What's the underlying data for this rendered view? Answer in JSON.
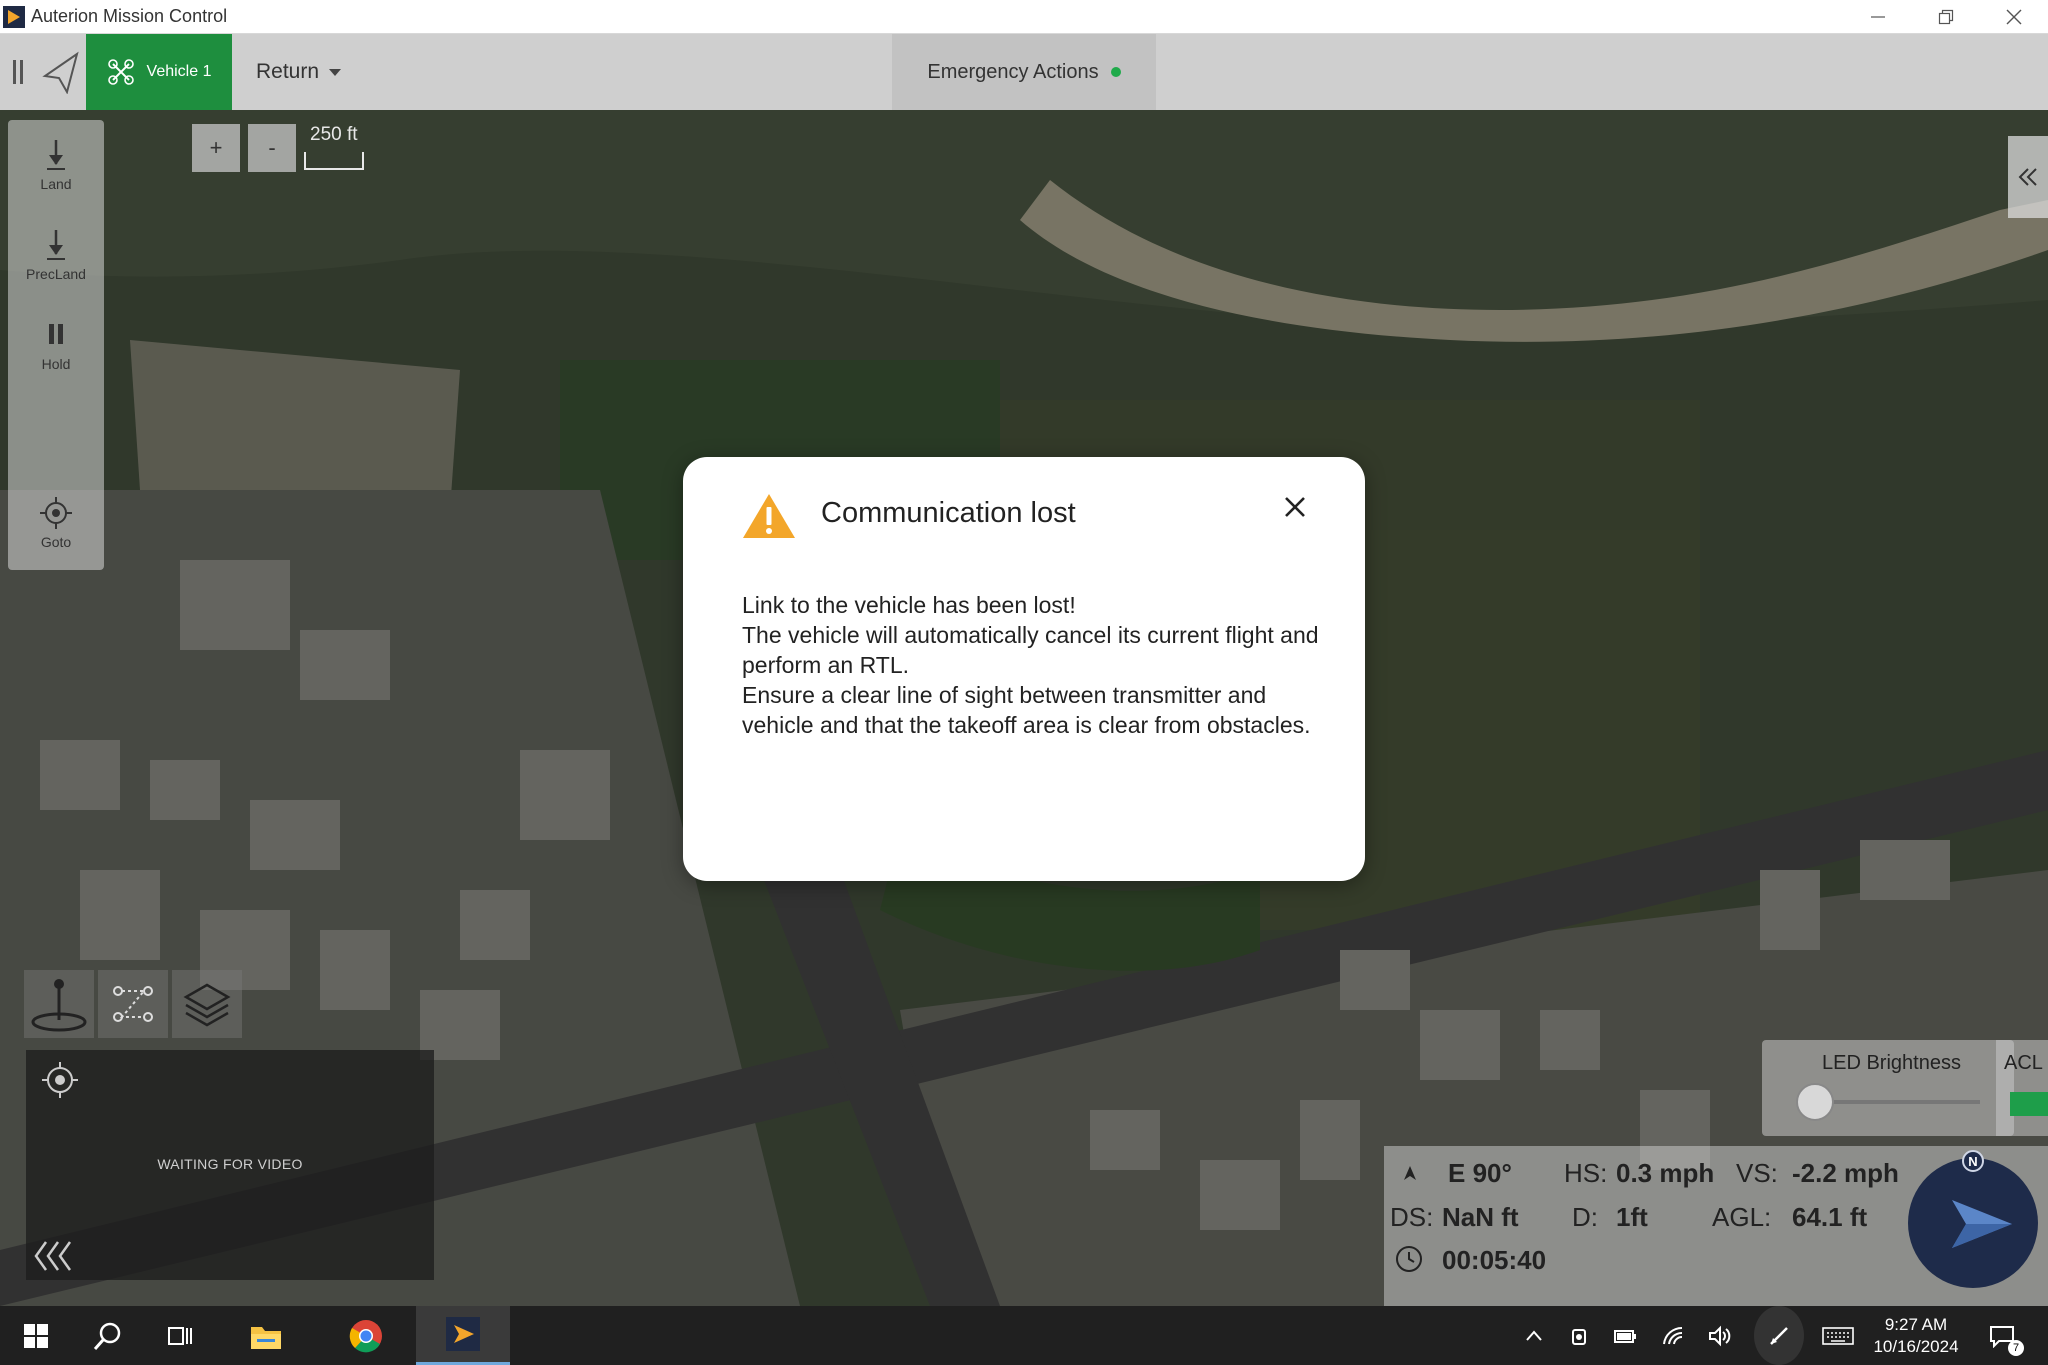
{
  "window": {
    "title": "Auterion Mission Control"
  },
  "toolbar": {
    "vehicle_label": "Vehicle 1",
    "mode_label": "Return",
    "emergency_label": "Emergency Actions",
    "status_color": "#1faa4a"
  },
  "map": {
    "zoom_in": "+",
    "zoom_out": "-",
    "scale": "250 ft"
  },
  "actions": [
    {
      "label": "Land",
      "icon": "land-icon"
    },
    {
      "label": "PrecLand",
      "icon": "precland-icon"
    },
    {
      "label": "Hold",
      "icon": "pause-icon"
    },
    {
      "label": "Goto",
      "icon": "target-icon"
    }
  ],
  "dialog": {
    "title": "Communication lost",
    "lines": [
      "Link to the vehicle has been lost!",
      "The vehicle will automatically cancel its current flight and perform an RTL.",
      "Ensure a clear line of sight between transmitter and vehicle and that the takeoff area is clear from obstacles."
    ]
  },
  "video": {
    "status": "WAITING FOR VIDEO"
  },
  "led": {
    "label": "LED Brightness",
    "level": 0.0
  },
  "acl": {
    "label": "ACL",
    "color": "#1e9e4a"
  },
  "telemetry": {
    "heading": "E 90°",
    "hs_label": "HS:",
    "hs_value": "0.3 mph",
    "vs_label": "VS:",
    "vs_value": "-2.2 mph",
    "ds_label": "DS:",
    "ds_value": "NaN ft",
    "d_label": "D:",
    "d_value": "1ft",
    "agl_label": "AGL:",
    "agl_value": "64.1 ft",
    "flight_time": "00:05:40",
    "compass_n": "N"
  },
  "taskbar": {
    "time": "9:27 AM",
    "date": "10/16/2024",
    "notifications": "7"
  }
}
